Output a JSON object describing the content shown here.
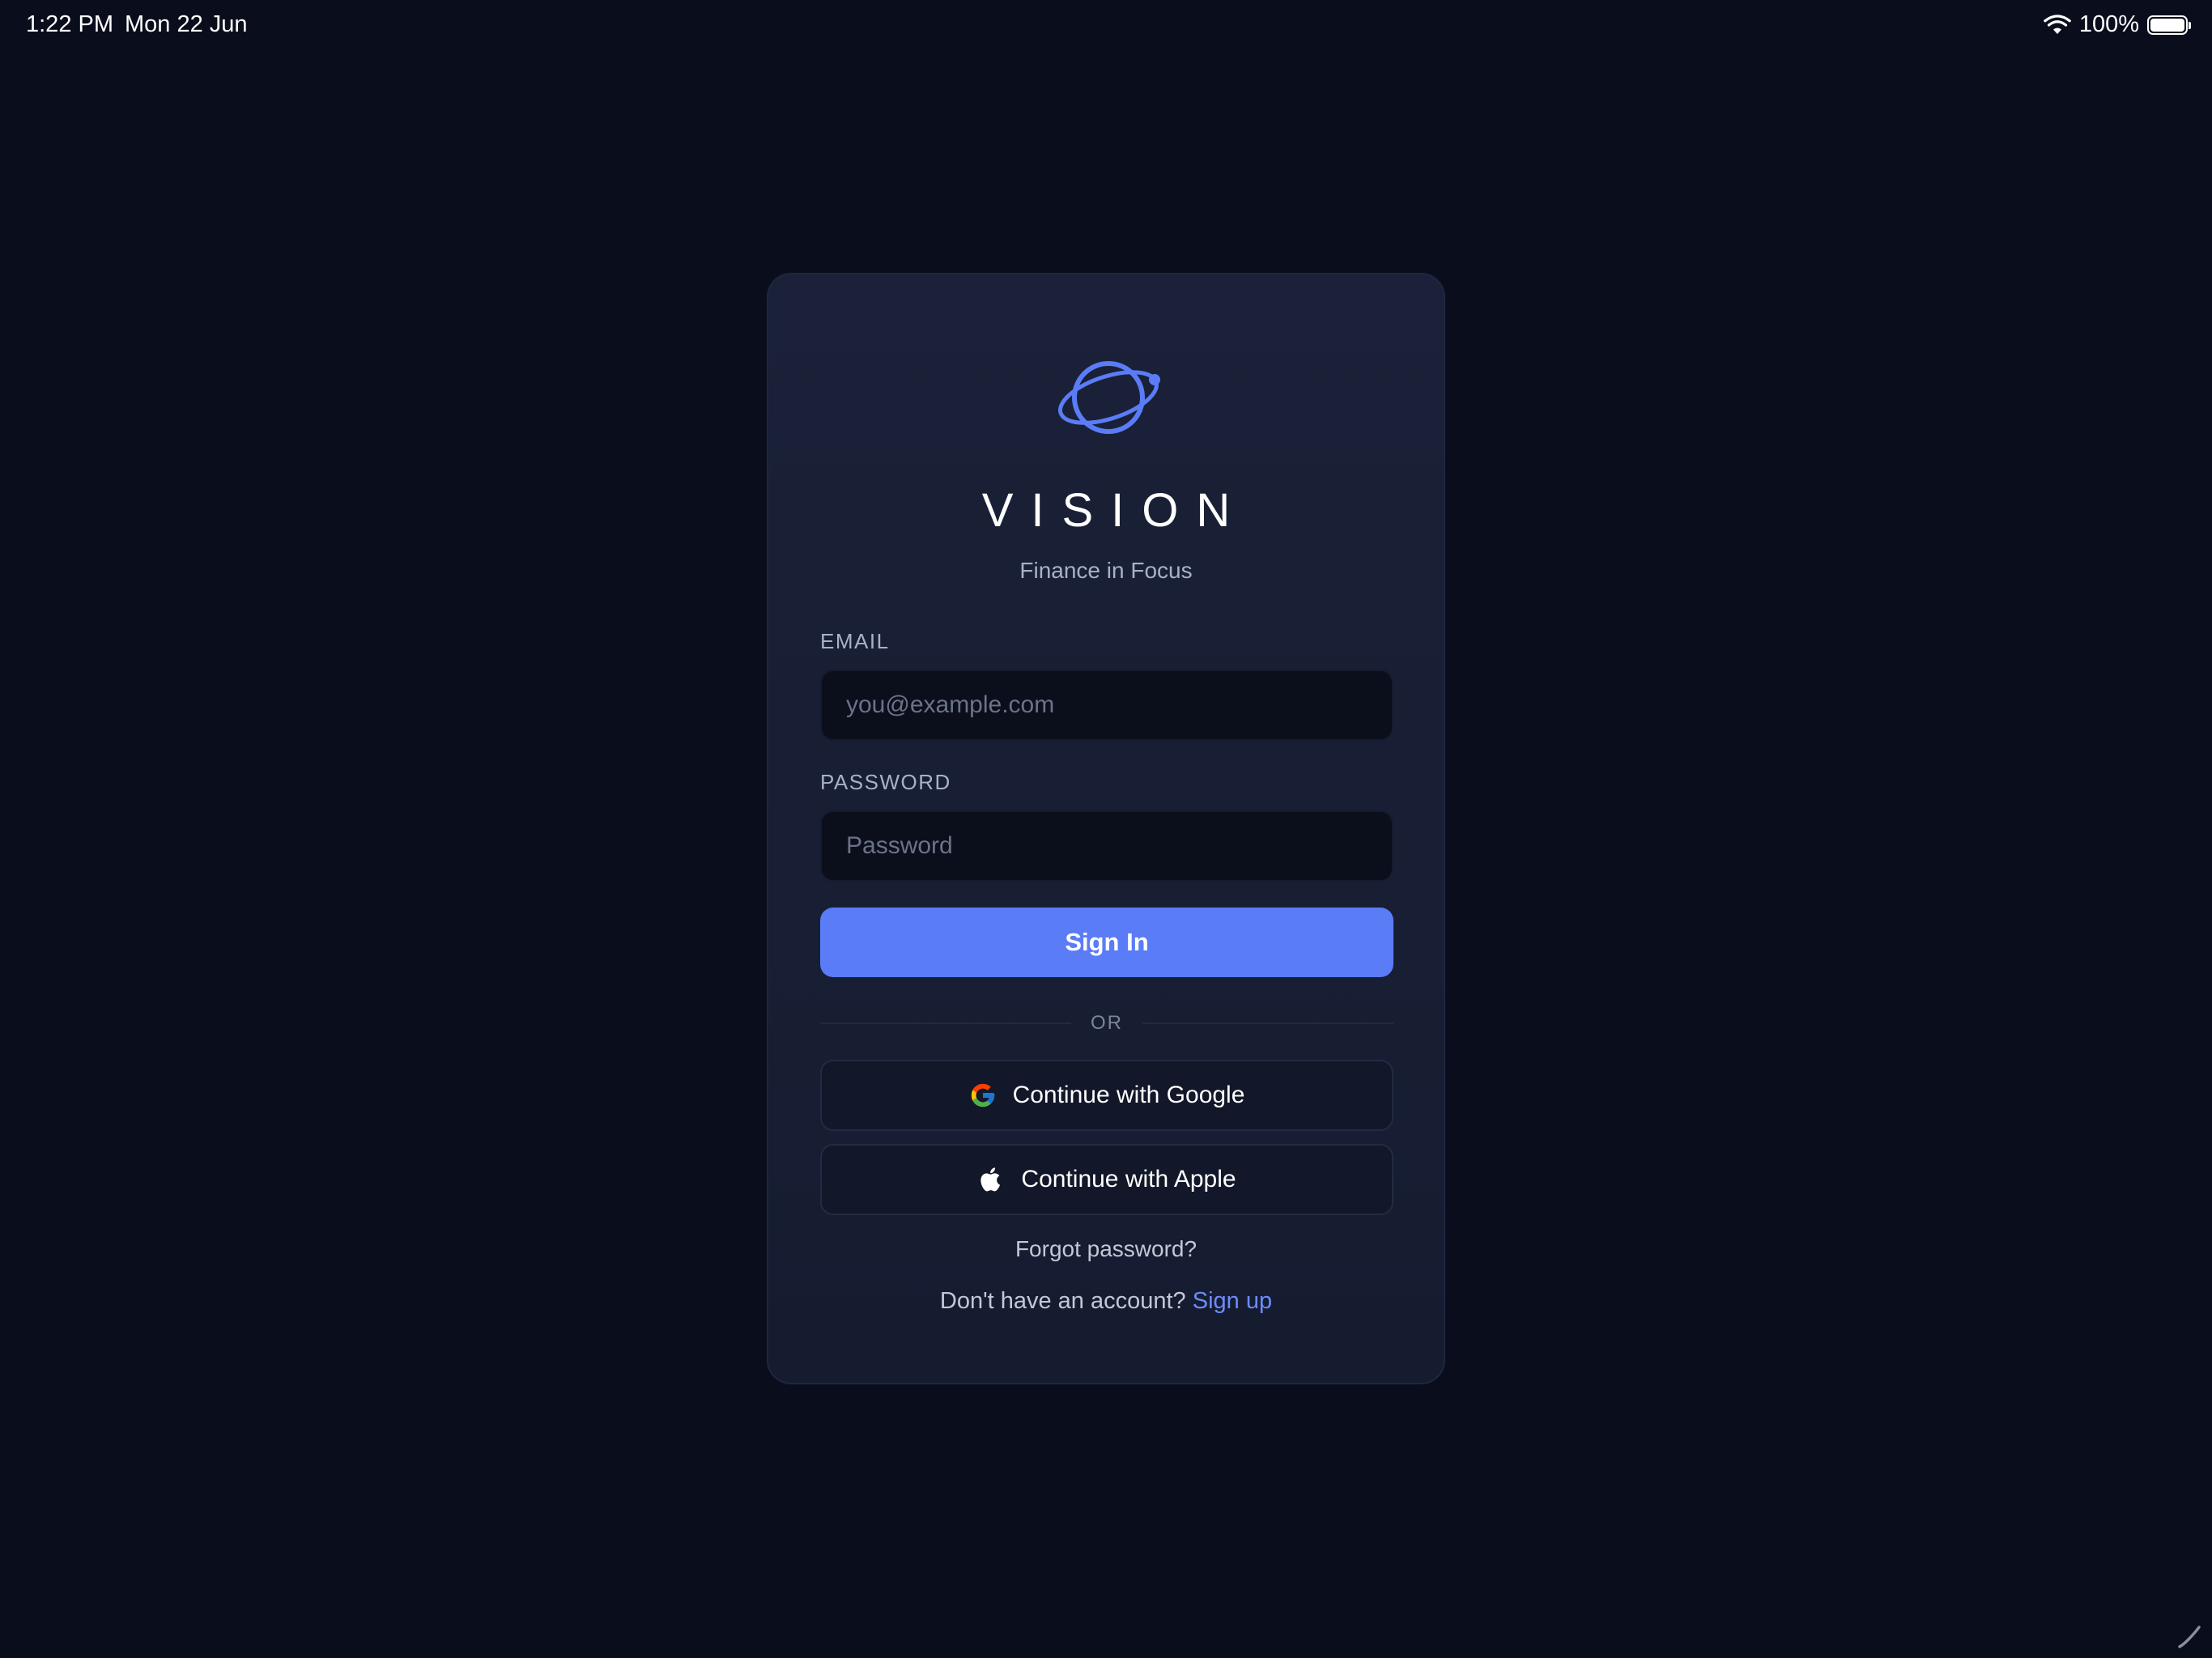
{
  "status_bar": {
    "time": "1:22 PM",
    "date": "Mon 22 Jun",
    "battery_percent": "100%",
    "icons": [
      "wifi-icon",
      "battery-icon"
    ]
  },
  "brand": {
    "logo_icon": "planet-orbit-icon",
    "name": "VISION",
    "tagline": "Finance in Focus",
    "accent_color": "#5b7cf7"
  },
  "form": {
    "email": {
      "label": "EMAIL",
      "placeholder": "you@example.com",
      "value": ""
    },
    "password": {
      "label": "PASSWORD",
      "placeholder": "Password",
      "value": ""
    },
    "submit_label": "Sign In",
    "divider_text": "OR"
  },
  "social": {
    "google_label": "Continue with Google",
    "google_icon": "google-icon",
    "apple_label": "Continue with Apple",
    "apple_icon": "apple-icon"
  },
  "links": {
    "forgot_password": "Forgot password?",
    "signup_prompt": "Don't have an account?",
    "signup_link": "Sign up"
  },
  "colors": {
    "background": "#0a0e1c",
    "card": "#1a2138",
    "input_bg": "#0b0f1c",
    "primary_button": "#5b7cf7",
    "link": "#6d8cff"
  }
}
